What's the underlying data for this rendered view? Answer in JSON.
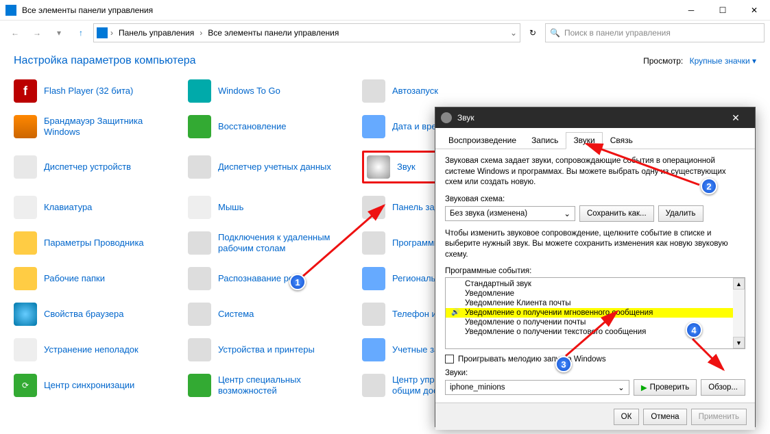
{
  "window": {
    "title": "Все элементы панели управления"
  },
  "nav": {
    "crumb1": "Панель управления",
    "crumb2": "Все элементы панели управления",
    "search_placeholder": "Поиск в панели управления"
  },
  "header": {
    "heading": "Настройка параметров компьютера",
    "view_label": "Просмотр:",
    "view_value": "Крупные значки ▾"
  },
  "items": {
    "flash": "Flash Player (32 бита)",
    "wtg": "Windows To Go",
    "autorun": "Автозапуск",
    "firewall": "Брандмауэр Защитника Windows",
    "restore": "Восстановление",
    "datetime": "Дата и время",
    "devmgr": "Диспетчер устройств",
    "creds": "Диспетчер учетных данных",
    "sound": "Звук",
    "keyboard": "Клавиатура",
    "mouse": "Мышь",
    "navpanel": "Панель задач и навигация",
    "explorer": "Параметры Проводника",
    "remote": "Подключения к удаленным рабочим столам",
    "programs": "Программы и компоненты",
    "workdirs": "Рабочие папки",
    "speech": "Распознавание речи",
    "regional": "Региональные стандарты",
    "browser": "Свойства браузера",
    "system": "Система",
    "modem": "Телефон и модем",
    "trouble": "Устранение неполадок",
    "devprint": "Устройства и принтеры",
    "accounts": "Учетные записи пользователей",
    "sync": "Центр синхронизации",
    "access": "Центр специальных возможностей",
    "updshare": "Центр управления сетями и общим доступом"
  },
  "sound_dialog": {
    "title": "Звук",
    "tabs": {
      "playback": "Воспроизведение",
      "record": "Запись",
      "sounds": "Звуки",
      "comm": "Связь"
    },
    "desc": "Звуковая схема задает звуки, сопровождающие события в операционной системе Windows и программах. Вы можете выбрать одну из существующих схем или создать новую.",
    "scheme_label": "Звуковая схема:",
    "scheme_value": "Без звука (изменена)",
    "save_as": "Сохранить как...",
    "delete": "Удалить",
    "events_desc": "Чтобы изменить звуковое сопровождение, щелкните событие в списке и выберите нужный звук. Вы можете сохранить изменения как новую звуковую схему.",
    "events_label": "Программные события:",
    "events": [
      "Стандартный звук",
      "Уведомление",
      "Уведомление Клиента почты",
      "Уведомление о получении мгновенного сообщения",
      "Уведомление о получении почты",
      "Уведомление о получении текстового сообщения"
    ],
    "play_startup": "Проигрывать мелодию запуска Windows",
    "sounds_label": "Звуки:",
    "sounds_value": "iphone_minions",
    "check": "Проверить",
    "browse": "Обзор...",
    "ok": "ОК",
    "cancel": "Отмена",
    "apply": "Применить"
  },
  "markers": {
    "m1": "1",
    "m2": "2",
    "m3": "3",
    "m4": "4"
  }
}
